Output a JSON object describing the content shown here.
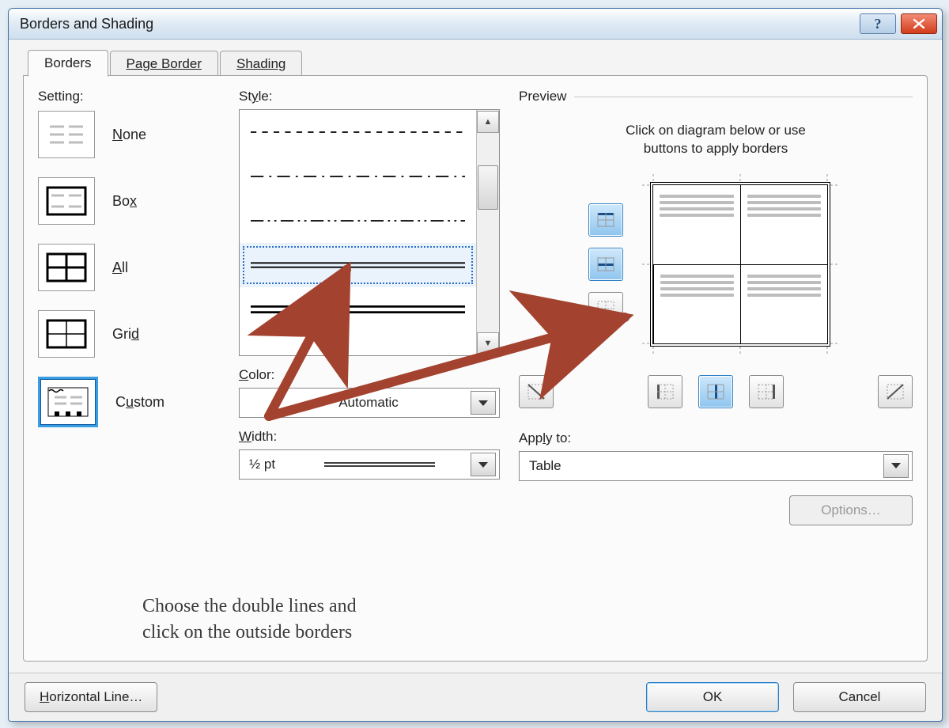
{
  "title": "Borders and Shading",
  "tabs": {
    "borders": "Borders",
    "page_border": "Page Border",
    "shading": "Shading"
  },
  "setting": {
    "label": "Setting:",
    "none": "None",
    "box": "Box",
    "all": "All",
    "grid": "Grid",
    "custom": "Custom"
  },
  "style": {
    "label": "Style:"
  },
  "color": {
    "label": "Color:",
    "value": "Automatic"
  },
  "width": {
    "label": "Width:",
    "value": "½ pt"
  },
  "preview": {
    "label": "Preview",
    "hint1": "Click on diagram below or use",
    "hint2": "buttons to apply borders"
  },
  "apply_to": {
    "label": "Apply to:",
    "value": "Table"
  },
  "buttons": {
    "options": "Options…",
    "horizontal_line": "Horizontal Line…",
    "ok": "OK",
    "cancel": "Cancel"
  },
  "annotation": {
    "line1": "Choose the double lines and",
    "line2": "click on the outside borders"
  }
}
